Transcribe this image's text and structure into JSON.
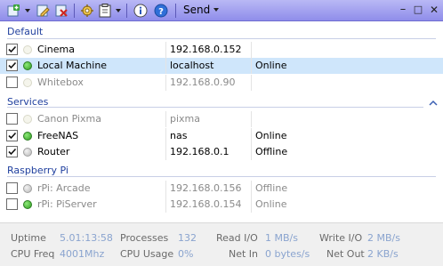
{
  "toolbar": {
    "send_label": "Send",
    "icons": [
      "add-icon",
      "edit-icon",
      "delete-icon",
      "settings-icon",
      "clipboard-icon",
      "info-icon",
      "help-icon"
    ],
    "window_buttons": {
      "minimize": "–",
      "maximize": "□",
      "close": "✕"
    }
  },
  "groups": [
    {
      "title": "Default"
    },
    {
      "title": "Services"
    },
    {
      "title": "Raspberry Pi"
    }
  ],
  "hosts": [
    {
      "checked": true,
      "status": "pale",
      "name": "Cinema",
      "address": "192.168.0.152",
      "state": "",
      "dim": false,
      "selected": false
    },
    {
      "checked": true,
      "status": "green",
      "name": "Local Machine",
      "address": "localhost",
      "state": "Online",
      "dim": false,
      "selected": true
    },
    {
      "checked": false,
      "status": "pale",
      "name": "Whitebox",
      "address": "192.168.0.90",
      "state": "",
      "dim": true,
      "selected": false
    },
    {
      "checked": false,
      "status": "pale",
      "name": "Canon Pixma",
      "address": "pixma",
      "state": "",
      "dim": true,
      "selected": false
    },
    {
      "checked": true,
      "status": "green",
      "name": "FreeNAS",
      "address": "nas",
      "state": "Online",
      "dim": false,
      "selected": false
    },
    {
      "checked": true,
      "status": "grey",
      "name": "Router",
      "address": "192.168.0.1",
      "state": "Offline",
      "dim": false,
      "selected": false
    },
    {
      "checked": false,
      "status": "grey",
      "name": "rPi: Arcade",
      "address": "192.168.0.156",
      "state": "Offline",
      "dim": true,
      "selected": false
    },
    {
      "checked": false,
      "status": "green",
      "name": "rPi: PiServer",
      "address": "192.168.0.154",
      "state": "Online",
      "dim": true,
      "selected": false
    }
  ],
  "footer": {
    "uptime_label": "Uptime",
    "uptime_value": "5.01:13:58",
    "processes_label": "Processes",
    "processes_value": "132",
    "read_label": "Read I/O",
    "read_value": "1 MB/s",
    "write_label": "Write I/O",
    "write_value": "2 MB/s",
    "cpufreq_label": "CPU Freq",
    "cpufreq_value": "4001Mhz",
    "cpuusage_label": "CPU Usage",
    "cpuusage_value": "0%",
    "netin_label": "Net In",
    "netin_value": "0 bytes/s",
    "netout_label": "Net Out",
    "netout_value": "2 KB/s"
  },
  "colors": {
    "toolbar": "#9f9df0",
    "group_header": "#1f3f9e",
    "selection": "#cfe6fb",
    "footer_value": "#8aa4cf"
  }
}
